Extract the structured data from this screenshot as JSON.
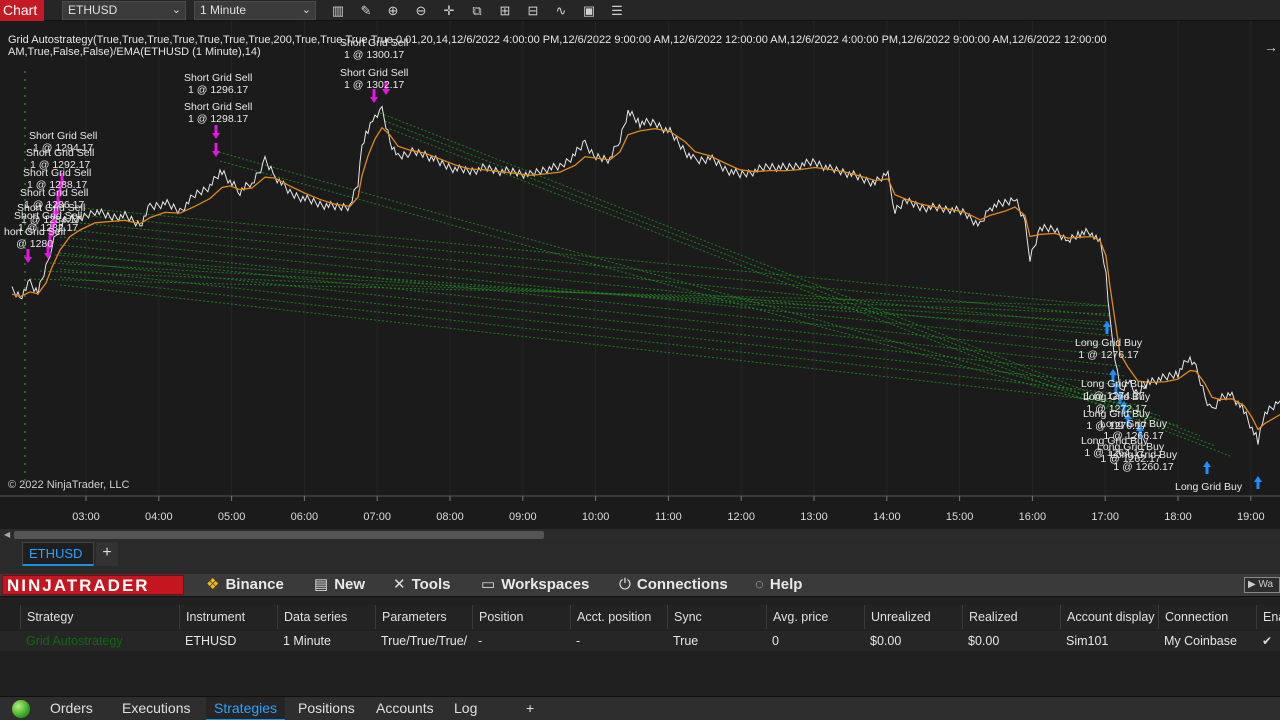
{
  "toolbar": {
    "badge": "Chart",
    "instrument": "ETHUSD",
    "interval": "1 Minute",
    "icons": [
      "bar-type-icon",
      "drawing-tool-icon",
      "zoom-in-icon",
      "zoom-out-icon",
      "crosshair-icon",
      "data-box-icon",
      "chart-style-icon",
      "chart-trader-icon",
      "indicators-icon",
      "strategies-icon",
      "properties-icon"
    ]
  },
  "chart": {
    "strategy_header": "Grid Autostrategy(True,True,True,True,True,True,True,200,True,True,True,True,0.01,20,14,12/6/2022 4:00:00 PM,12/6/2022 9:00:00 AM,12/6/2022 12:00:00 AM,12/6/2022 4:00:00 PM,12/6/2022 9:00:00 AM,12/6/2022 12:00:00 AM,True,False,False)/EMA(ETHUSD (1 Minute),14)",
    "copyright": "© 2022 NinjaTrader, LLC",
    "time_labels": [
      "03:00",
      "04:00",
      "05:00",
      "06:00",
      "07:00",
      "08:00",
      "09:00",
      "10:00",
      "11:00",
      "12:00",
      "13:00",
      "14:00",
      "15:00",
      "16:00",
      "17:00",
      "18:00",
      "19:00"
    ],
    "colors": {
      "price": "#e8e8e8",
      "ema": "#e08a1c",
      "sell_marker": "#e216e2",
      "buy_marker": "#1e8fff",
      "grid_line": "#1f8a1f",
      "background": "#1b1b1b"
    },
    "signals": [
      {
        "line1": "Short Grid Sell",
        "line2": "1 @ 1296.17"
      },
      {
        "line1": "Short Grid Sell",
        "line2": "1 @ 1298.17"
      },
      {
        "line1": "Short Grid Sell",
        "line2": "1 @ 1300.17"
      },
      {
        "line1": "Short Grid Sell",
        "line2": "1 @ 1302.17"
      },
      {
        "line1": "Short Grid Sell",
        "line2": "1 @ 1294.17"
      },
      {
        "line1": "Short Grid Sell",
        "line2": "1 @ 1292.17"
      },
      {
        "line1": "Short Grid Sell",
        "line2": "1 @ 1288.17"
      },
      {
        "line1": "Short Grid Sell",
        "line2": "1 @ 1286.17"
      },
      {
        "line1": "Short Grid Sell",
        "line2": "1 @ 1284.17"
      },
      {
        "line1": "Short Grid Sell",
        "line2": "1 @ 1282.17"
      },
      {
        "line1": "hort Grid Sell",
        "line2": "@ 1280"
      },
      {
        "line1": "Long Grid Buy",
        "line2": "1 @ 1276.17"
      },
      {
        "line1": "Long Grid Buy",
        "line2": "1 @ 1274.17"
      },
      {
        "line1": "Long Grid Buy",
        "line2": "1 @ 1272.17"
      },
      {
        "line1": "Long Grid Buy",
        "line2": "1 @ 1270.17"
      },
      {
        "line1": "Long Grid Buy",
        "line2": "1 @ 1266.17"
      },
      {
        "line1": "Long Grid Buy",
        "line2": "1 @ 1264.17"
      },
      {
        "line1": "Long Grid Buy",
        "line2": "1 @ 1262.17"
      },
      {
        "line1": "Long Grid Buy",
        "line2": "1 @ 1260.17"
      },
      {
        "line1": "Long Grid Buy",
        "line2": ""
      }
    ]
  },
  "chart_tab": {
    "label": "ETHUSD",
    "add": "+"
  },
  "menubar": {
    "logo": "NINJATRADER",
    "items": [
      {
        "icon": "❖",
        "label": "Binance"
      },
      {
        "icon": "▤",
        "label": "New"
      },
      {
        "icon": "✕",
        "label": "Tools"
      },
      {
        "icon": "▭",
        "label": "Workspaces"
      },
      {
        "icon": "⏻",
        "label": "Connections"
      },
      {
        "icon": "◌",
        "label": "Help"
      }
    ],
    "watch": "Wa"
  },
  "grid": {
    "headers": [
      "Strategy",
      "Instrument",
      "Data series",
      "Parameters",
      "Position",
      "Acct. position",
      "Sync",
      "Avg. price",
      "Unrealized",
      "Realized",
      "Account display",
      "Connection",
      "Ena"
    ],
    "row": {
      "strategy": "Grid Autostrategy",
      "instrument": "ETHUSD",
      "data_series": "1 Minute",
      "parameters": "True/True/True/",
      "position": "-",
      "acct_position": "-",
      "sync": "True",
      "avg_price": "0",
      "unrealized": "$0.00",
      "realized": "$0.00",
      "account_display": "Sim101",
      "connection": "My Coinbase",
      "enabled": "✔"
    }
  },
  "bottom_tabs": [
    "Orders",
    "Executions",
    "Strategies",
    "Positions",
    "Accounts",
    "Log",
    "+"
  ],
  "bottom_active": "Strategies"
}
